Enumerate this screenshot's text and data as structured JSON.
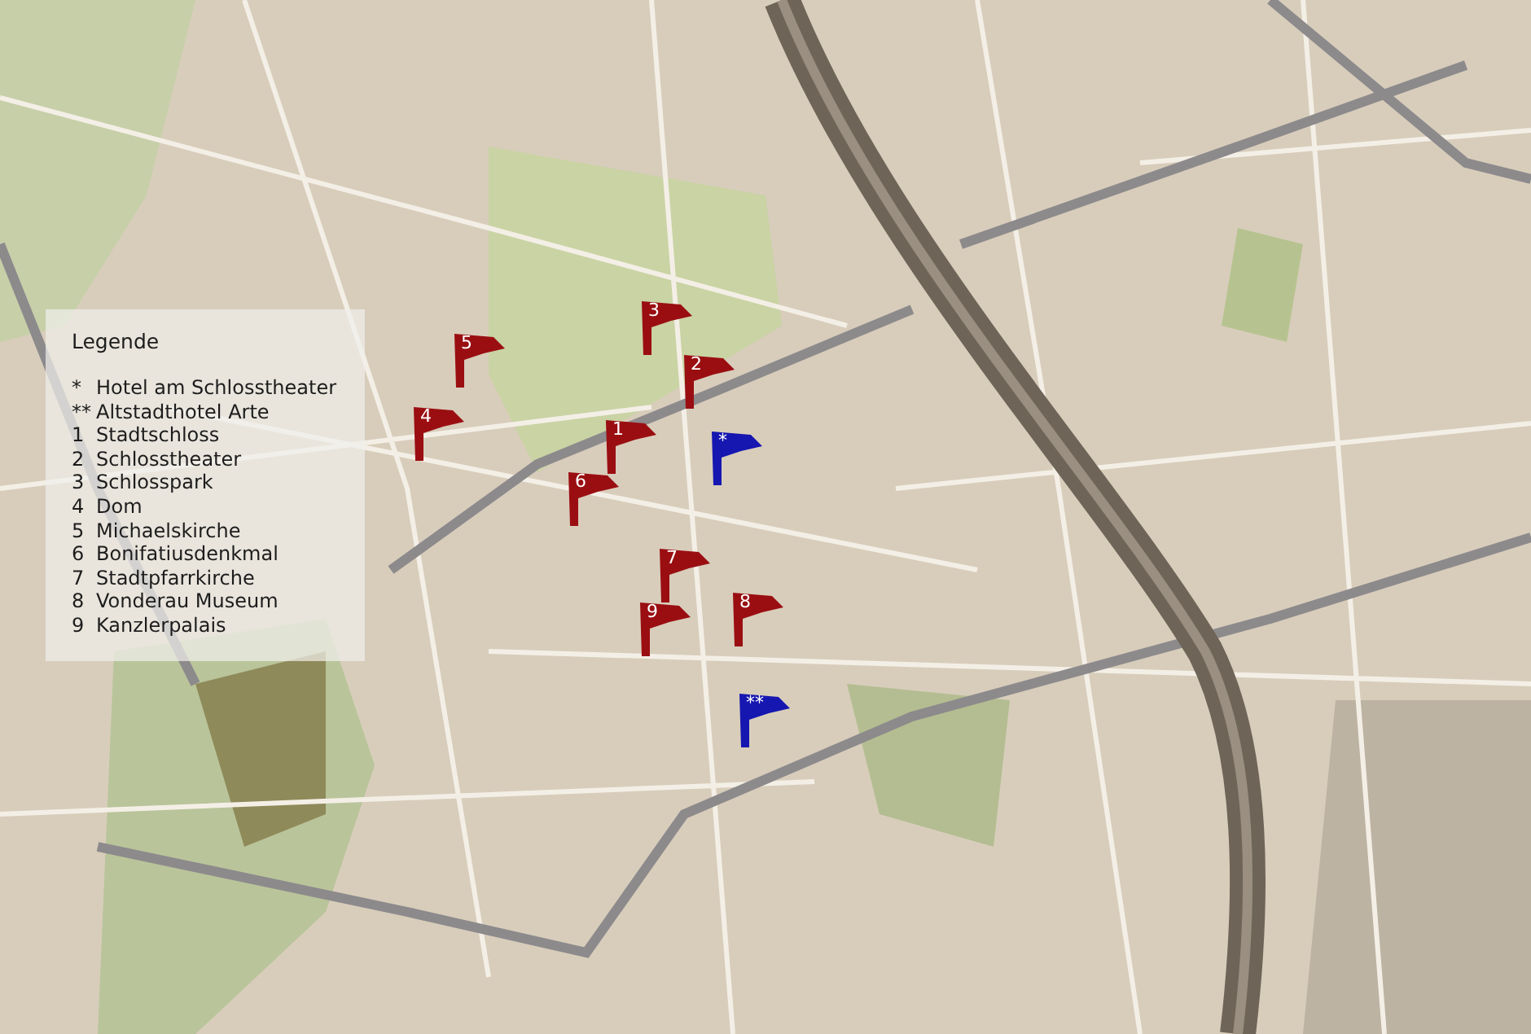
{
  "legend": {
    "title": "Legende",
    "entries": [
      {
        "mark": "*",
        "name": "Hotel am Schlosstheater"
      },
      {
        "mark": "**",
        "name": "Altstadthotel Arte"
      },
      {
        "mark": "1",
        "name": "Stadtschloss"
      },
      {
        "mark": "2",
        "name": "Schlosstheater"
      },
      {
        "mark": "3",
        "name": "Schlosspark"
      },
      {
        "mark": "4",
        "name": "Dom"
      },
      {
        "mark": "5",
        "name": "Michaelskirche"
      },
      {
        "mark": "6",
        "name": "Bonifatiusdenkmal"
      },
      {
        "mark": "7",
        "name": "Stadtpfarrkirche"
      },
      {
        "mark": "8",
        "name": "Vonderau Museum"
      },
      {
        "mark": "9",
        "name": "Kanzlerpalais"
      }
    ]
  },
  "markers": [
    {
      "label": "3",
      "color": "#9a0e12"
    },
    {
      "label": "2",
      "color": "#9a0e12"
    },
    {
      "label": "1",
      "color": "#9a0e12"
    },
    {
      "label": "5",
      "color": "#9a0e12"
    },
    {
      "label": "4",
      "color": "#9a0e12"
    },
    {
      "label": "6",
      "color": "#9a0e12"
    },
    {
      "label": "7",
      "color": "#9a0e12"
    },
    {
      "label": "9",
      "color": "#9a0e12"
    },
    {
      "label": "8",
      "color": "#9a0e12"
    },
    {
      "label": "*",
      "color": "#1616b0"
    },
    {
      "label": "**",
      "color": "#1616b0"
    }
  ]
}
